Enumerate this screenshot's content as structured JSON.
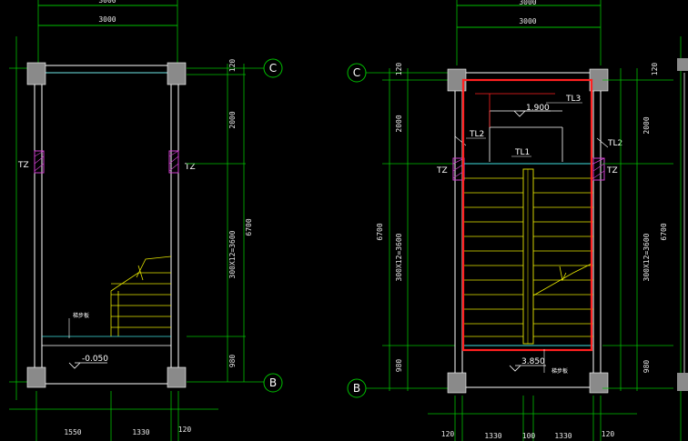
{
  "colors": {
    "background": "#000000",
    "grid_green": "#00c000",
    "dim_line": "#00c000",
    "wall": "#ffffff",
    "column_fill": "#8a8a8a",
    "stair_yellow": "#e6e600",
    "cyan": "#40e0e0",
    "magenta": "#d040d0",
    "highlight_red": "#ff2020",
    "text": "#ffffff"
  },
  "left_plan": {
    "top_dims": [
      "3000",
      "3000"
    ],
    "right_dims": [
      "120",
      "2000",
      "300X12=3600",
      "6700",
      "980"
    ],
    "bottom_dims": [
      "1550",
      "1330",
      "120"
    ],
    "axis_top": "C",
    "axis_bottom": "B",
    "column_tags": [
      "TZ",
      "TZ"
    ],
    "elevation": "-0.050",
    "note": "梯步板"
  },
  "right_plan": {
    "top_dims": [
      "3000",
      "3000"
    ],
    "left_dims": [
      "120",
      "2000",
      "300X12=3600",
      "6700",
      "980"
    ],
    "right_dims": [
      "120",
      "2000",
      "300X12=3600",
      "6700",
      "980"
    ],
    "bottom_dims": [
      "120",
      "1330",
      "100",
      "1330",
      "120"
    ],
    "axis_top": "C",
    "axis_bottom": "B",
    "column_tags": [
      "TZ",
      "TZ"
    ],
    "beam_tags": [
      "TL3",
      "TL2",
      "TL2",
      "TL1"
    ],
    "landing_elevation": "1.900",
    "floor_elevation": "3.850",
    "note": "梯步板"
  }
}
